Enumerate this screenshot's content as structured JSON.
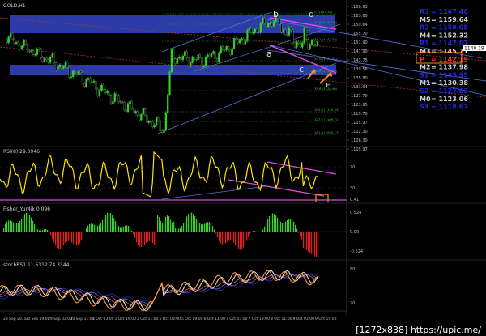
{
  "symbol_title": "GOLD,H1",
  "price_axis": {
    "ticks": [
      "1166.93",
      "1163.60",
      "1159.64",
      "1155.70",
      "1151.90",
      "1147.90",
      "1143.75",
      "1139.56",
      "1135.80",
      "1131.94",
      "1127.70",
      "1123.95",
      "1119.70",
      "1115.97",
      "1112.30",
      "1108.30",
      "1105.97"
    ]
  },
  "pivots": [
    {
      "label": "R3",
      "value": "1167.46",
      "color": "#1f2bd6"
    },
    {
      "label": "M5",
      "value": "1159.64",
      "color": "#d0d0d0"
    },
    {
      "label": "R2",
      "value": "1159.05",
      "color": "#1f2bd6"
    },
    {
      "label": "M4",
      "value": "1152.32",
      "color": "#d0d0d0"
    },
    {
      "label": "R1",
      "value": "1147.07",
      "color": "#1f2bd6"
    },
    {
      "label": "M3",
      "value": "1145.71",
      "color": "#d0d0d0"
    },
    {
      "label": "P",
      "value": "1142.19",
      "color": "#ff2a2a"
    },
    {
      "label": "M2",
      "value": "1137.98",
      "color": "#d0d0d0"
    },
    {
      "label": "S1",
      "value": "1135.35",
      "color": "#1f2bd6"
    },
    {
      "label": "M1",
      "value": "1130.38",
      "color": "#d0d0d0"
    },
    {
      "label": "S2",
      "value": "1127.62",
      "color": "#1f2bd6"
    },
    {
      "label": "M0",
      "value": "1123.06",
      "color": "#d0d0d0"
    },
    {
      "label": "S3",
      "value": "1118.67",
      "color": "#1f2bd6"
    }
  ],
  "current_price": "1140.19",
  "fib_levels": [
    "0 (1163.38)",
    "23.6 (1153.29)",
    "38.2 (1147.28)",
    "50.0 (1141.21)",
    "61.8 (1136.12)",
    "78.6 (1128.90)",
    "100.0 (1120.34)",
    "127.2 (1109.71)",
    "161.8 (1095.17)"
  ],
  "wave_labels": {
    "a": "a",
    "b": "b",
    "c": "c",
    "d": "d",
    "e": "e"
  },
  "rsi": {
    "title": "RSI(8) 29.0946",
    "levels": [
      "70",
      "52",
      "30",
      "0.41"
    ]
  },
  "fisher": {
    "title": "Fisher_Yur4ik 0.096",
    "levels": [
      "0.00",
      "0.524",
      "-0.524"
    ]
  },
  "stoch": {
    "title": "stochRS1 11.5312 74.3344",
    "levels": [
      "80",
      "20"
    ]
  },
  "time_axis": [
    "28 Sep 2015",
    "30 Sep 19:00",
    "29 Sep 03:00",
    "30 Sep 11:00",
    "1 Oct 03:00",
    "1 Oct 19:00",
    "2 Oct 11:00",
    "5 Oct 03:00",
    "5 Oct 19:00",
    "6 Oct 11:00",
    "7 Oct 03:00",
    "7 Oct 19:00",
    "8 Oct 11:00",
    "9 Oct 03:00",
    "9 Oct 19:00"
  ],
  "watermark": "[1272x838] https://upic.me/",
  "colors": {
    "up": "#38d12a",
    "down": "#e02020",
    "rsi": "#ffe400",
    "zone": "#2b3ba8",
    "magenta": "#d84be0",
    "orange": "#ff8c1a"
  }
}
